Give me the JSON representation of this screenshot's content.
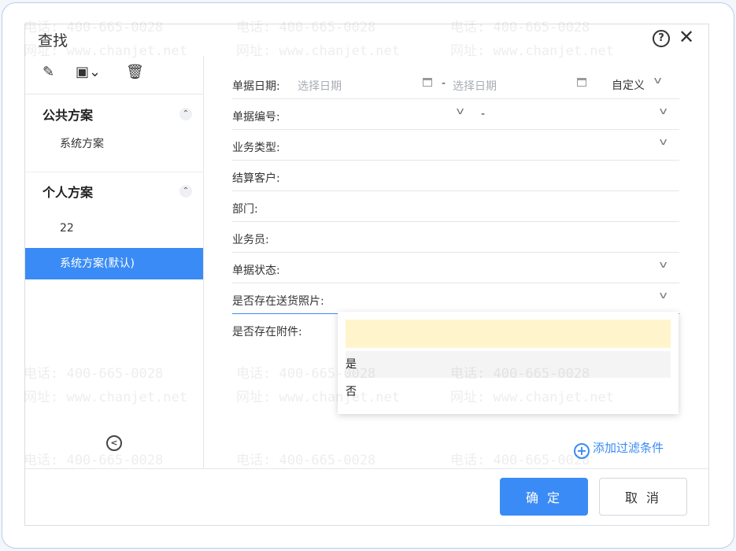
{
  "dialog": {
    "title": "查找",
    "help_icon": "question-circle-icon",
    "close_icon": "close-icon"
  },
  "sidebar": {
    "toolbar_icons": [
      "edit-icon",
      "save-icon",
      "delete-icon"
    ],
    "sections": [
      {
        "title": "公共方案",
        "items": [
          "系统方案"
        ]
      },
      {
        "title": "个人方案",
        "items": [
          "22",
          "系统方案(默认)"
        ]
      }
    ],
    "selected": "系统方案(默认)"
  },
  "form": {
    "date": {
      "label": "单据日期:",
      "start_placeholder": "选择日期",
      "separator": "-",
      "end_placeholder": "选择日期",
      "range_mode": "自定义"
    },
    "number": {
      "label": "单据编号:",
      "separator": "-"
    },
    "biz_type": {
      "label": "业务类型:"
    },
    "customer": {
      "label": "结算客户:"
    },
    "dept": {
      "label": "部门:"
    },
    "salesman": {
      "label": "业务员:"
    },
    "status": {
      "label": "单据状态:"
    },
    "delivery_photo": {
      "label": "是否存在送货照片:"
    },
    "attachment": {
      "label": "是否存在附件:"
    }
  },
  "dropdown": {
    "options": [
      "是",
      "否"
    ]
  },
  "add_filter": "添加过滤条件",
  "buttons": {
    "ok": "确 定",
    "cancel": "取 消"
  },
  "watermark": {
    "phone": "电话: 400-665-0028",
    "site": "网址: www.chanjet.net"
  }
}
